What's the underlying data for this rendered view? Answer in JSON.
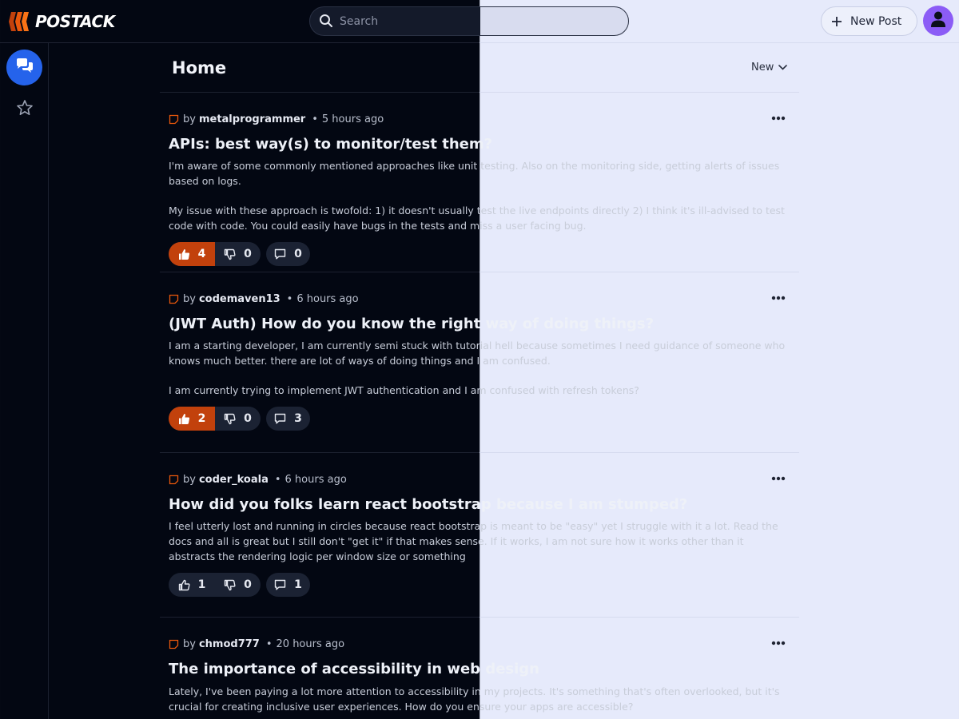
{
  "header": {
    "app_name": "POSTACK",
    "search_placeholder": "Search",
    "new_post_label": "New Post"
  },
  "main": {
    "title": "Home",
    "sort_label": "New"
  },
  "posts": [
    {
      "by": "by",
      "author": "metalprogrammer",
      "time": "5 hours ago",
      "title": "APIs: best way(s) to monitor/test them?",
      "paragraphs": [
        "I'm aware of some commonly mentioned approaches like unit testing. Also on the monitoring side, getting alerts of issues based on logs.",
        "My issue with these approach is twofold: 1) it doesn't usually test the live endpoints directly 2) I think it's ill-advised to test code with code. You could easily have bugs in the tests and miss a user facing bug."
      ],
      "upvotes": "4",
      "downvotes": "0",
      "comments": "0",
      "upvoted": true
    },
    {
      "by": "by",
      "author": "codemaven13",
      "time": "6 hours ago",
      "title": "(JWT Auth) How do you know the right way of doing things?",
      "paragraphs": [
        "I am a starting developer, I am currently semi stuck with tutorial hell because sometimes I need guidance of someone who knows much better. there are lot of ways of doing things and I am confused.",
        "I am currently trying to implement JWT authentication and I am confused with refresh tokens?"
      ],
      "upvotes": "2",
      "downvotes": "0",
      "comments": "3",
      "upvoted": true
    },
    {
      "by": "by",
      "author": "coder_koala",
      "time": "6 hours ago",
      "title": "How did you folks learn react bootstrap because I am stumped?",
      "paragraphs": [
        "I feel utterly lost and running in circles because react bootstrap is meant to be \"easy\" yet I struggle with it a lot. Read the docs and all is great but I still don't \"get it\" if that makes sense. If it works, I am not sure how it works other than it abstracts the rendering logic per window size or something"
      ],
      "upvotes": "1",
      "downvotes": "0",
      "comments": "1",
      "upvoted": false
    },
    {
      "by": "by",
      "author": "chmod777",
      "time": "20 hours ago",
      "title": "The importance of accessibility in web design",
      "paragraphs": [
        "Lately, I've been paying a lot more attention to accessibility in my projects. It's something that's often overlooked, but it's crucial for creating inclusive user experiences. How do you ensure your apps are accessible?"
      ],
      "upvoted": false
    }
  ],
  "icons": {
    "logo": "postack-logo-icon",
    "search": "search-icon",
    "new_post": "plus-icon",
    "avatar": "user-icon",
    "sidebar_feed": "chat-bubbles-icon",
    "sidebar_favorites": "star-icon",
    "sort": "chevron-down-icon",
    "post_tag": "note-icon",
    "more": "more-horizontal-icon",
    "upvote": "thumbs-up-icon",
    "downvote": "thumbs-down-icon",
    "comments": "comment-icon"
  },
  "colors": {
    "background_dark": "#030712",
    "background_light": "#e6eafb",
    "accent_blue": "#2563eb",
    "upvote_active": "#c2410c",
    "avatar": "#8b5cf6",
    "logo_orange": "#f97316"
  }
}
